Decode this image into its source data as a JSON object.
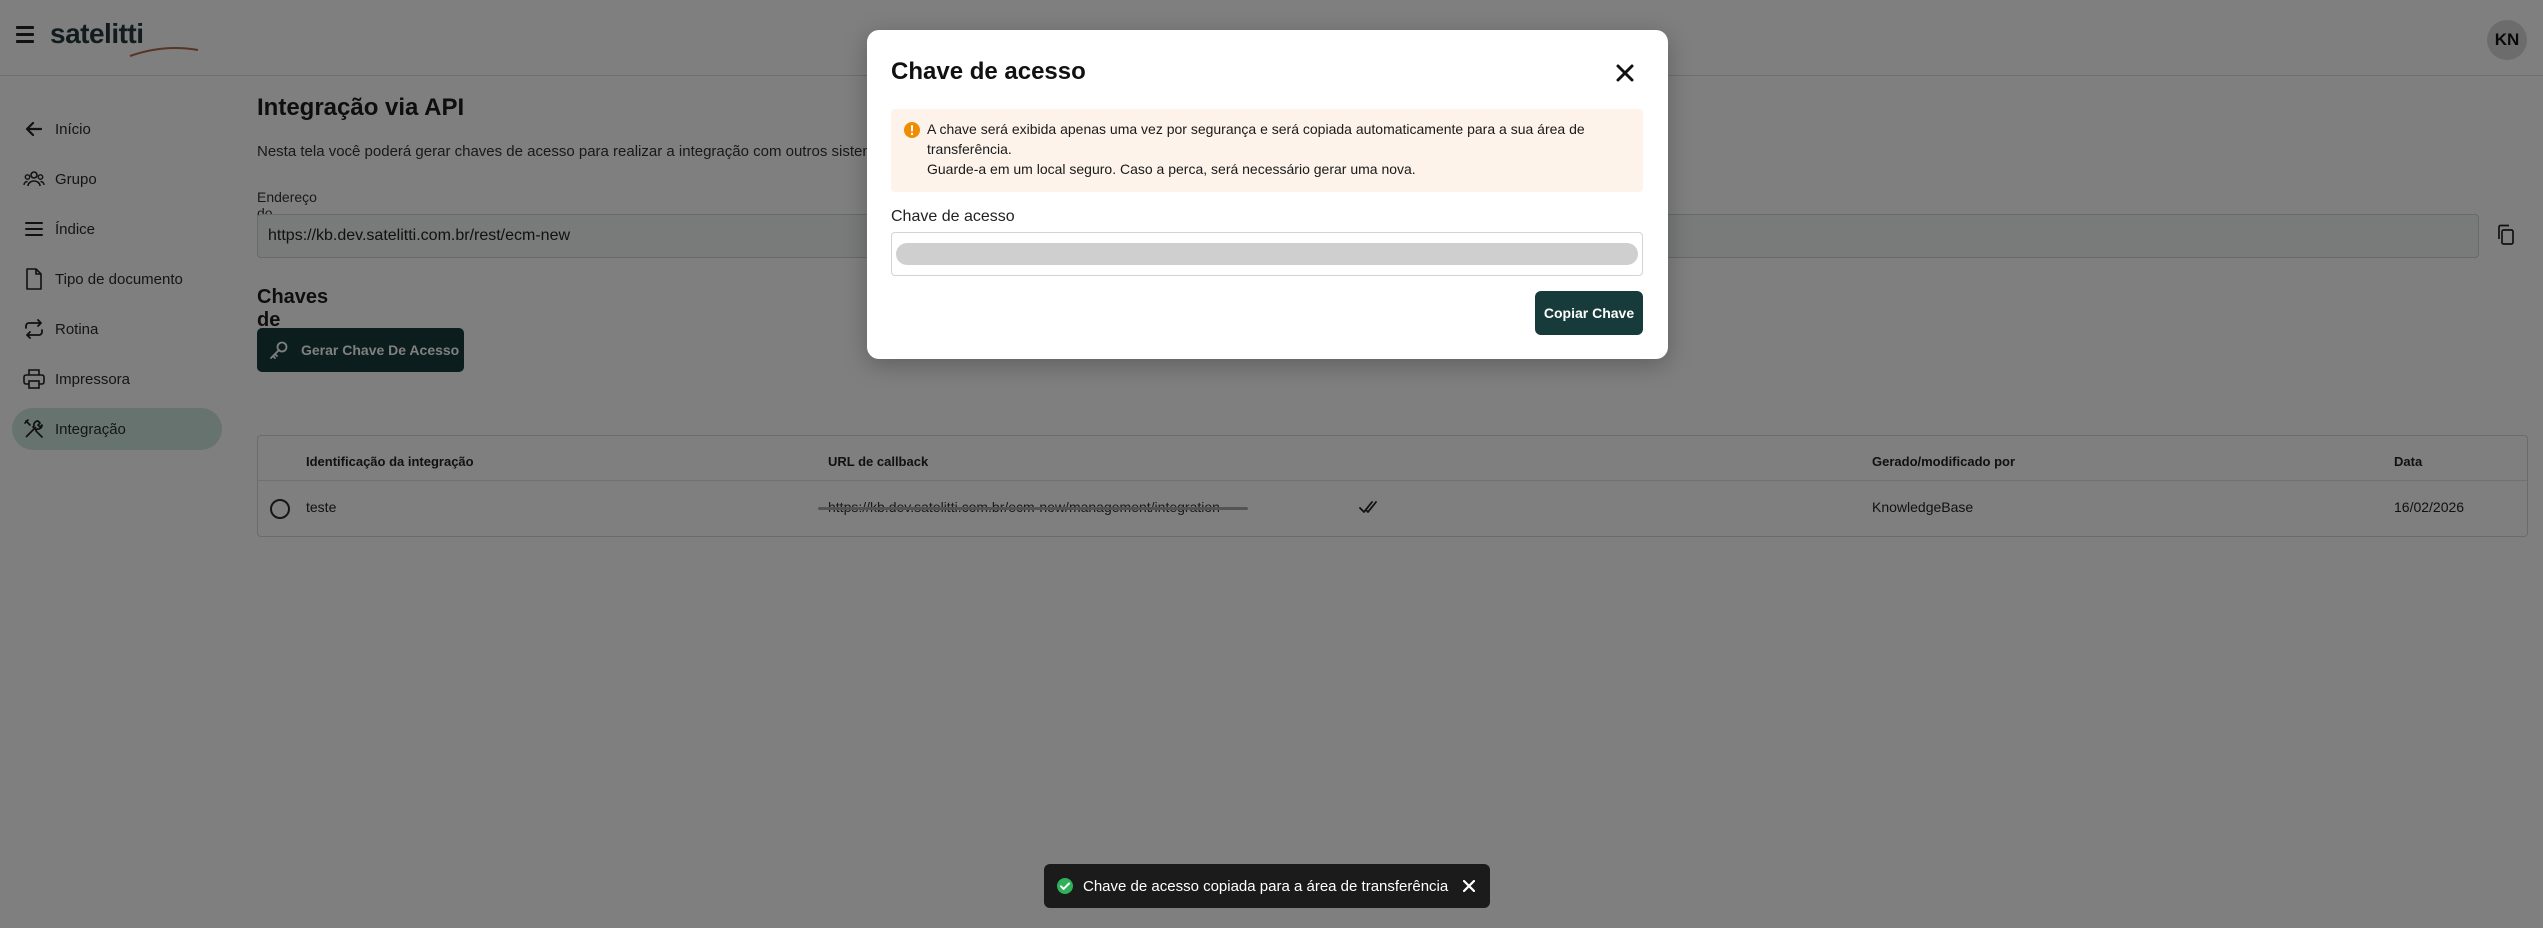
{
  "app": {
    "logo_text": "satelitti",
    "user_initials": "KN"
  },
  "sidebar": {
    "items": [
      {
        "label": "Início",
        "icon": "arrow-left-icon"
      },
      {
        "label": "Grupo",
        "icon": "group-icon"
      },
      {
        "label": "Índice",
        "icon": "list-icon"
      },
      {
        "label": "Tipo de documento",
        "icon": "document-icon"
      },
      {
        "label": "Rotina",
        "icon": "repeat-icon"
      },
      {
        "label": "Impressora",
        "icon": "printer-icon"
      },
      {
        "label": "Integração",
        "icon": "tools-icon",
        "active": true
      }
    ]
  },
  "page": {
    "title": "Integração via API",
    "description": "Nesta tela você poderá gerar chaves de acesso para realizar a integração com outros sistemas e a",
    "webservice_label": "Endereço do webservice",
    "webservice_value": "https://kb.dev.satelitti.com.br/rest/ecm-new",
    "keys_section_title": "Chaves de acesso",
    "generate_button": "Gerar Chave De Acesso"
  },
  "table": {
    "headers": [
      "Identificação da integração",
      "URL de callback",
      "Gerado/modificado por",
      "Data"
    ],
    "rows": [
      {
        "identification": "teste",
        "callback_url": "https://kb.dev.satelitti.com.br/ecm-new/management/integration",
        "modified_by": "KnowledgeBase",
        "date": "16/02/2026"
      }
    ]
  },
  "modal": {
    "title": "Chave de acesso",
    "alert_line1": "A chave será exibida apenas uma vez por segurança e será copiada automaticamente para a sua área de transferência.",
    "alert_line2": "Guarde-a em um local seguro. Caso a perca, será necessário gerar uma nova.",
    "field_label": "Chave de acesso",
    "copy_button": "Copiar Chave"
  },
  "toast": {
    "message": "Chave de acesso copiada para a área de transferência"
  },
  "colors": {
    "primary": "#173a3a",
    "active_nav": "#cfe6dc",
    "alert_bg": "#fdf3ea",
    "warning": "#f08c00",
    "success": "#2fb15a"
  }
}
